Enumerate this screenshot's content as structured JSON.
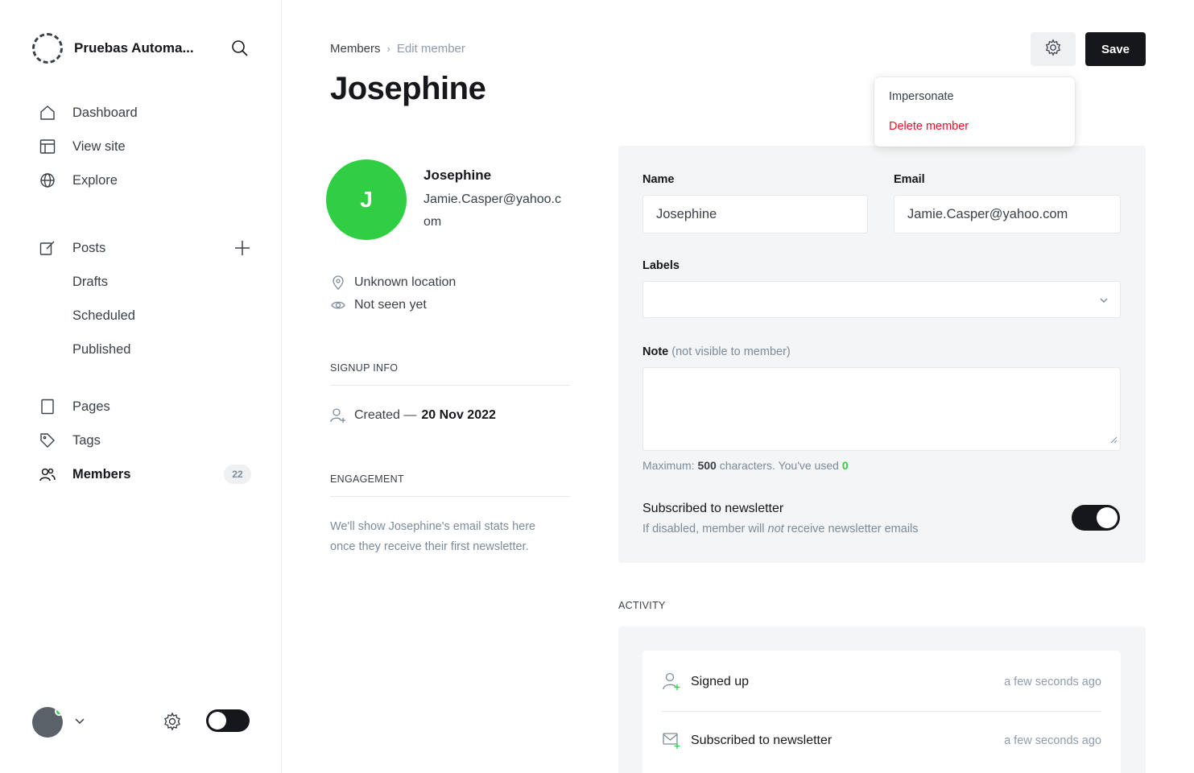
{
  "site": {
    "name": "Pruebas Automa..."
  },
  "nav": {
    "dashboard": "Dashboard",
    "view_site": "View site",
    "explore": "Explore",
    "posts": "Posts",
    "drafts": "Drafts",
    "scheduled": "Scheduled",
    "published": "Published",
    "pages": "Pages",
    "tags": "Tags",
    "members": "Members",
    "members_count": "22"
  },
  "breadcrumb": {
    "parent": "Members",
    "current": "Edit member"
  },
  "page": {
    "title": "Josephine"
  },
  "header": {
    "save_label": "Save"
  },
  "dropdown": {
    "impersonate": "Impersonate",
    "delete": "Delete member"
  },
  "profile": {
    "initial": "J",
    "name": "Josephine",
    "email": "Jamie.Casper@yahoo.com",
    "location": "Unknown location",
    "seen": "Not seen yet"
  },
  "signup": {
    "title": "SIGNUP INFO",
    "created_label": "Created —",
    "created_date": "20 Nov 2022"
  },
  "engagement": {
    "title": "ENGAGEMENT",
    "text": "We'll show Josephine's email stats here once they receive their first newsletter."
  },
  "form": {
    "name_label": "Name",
    "name_value": "Josephine",
    "email_label": "Email",
    "email_value": "Jamie.Casper@yahoo.com",
    "labels_label": "Labels",
    "note_label": "Note",
    "note_hint": "(not visible to member)",
    "max_prefix": "Maximum:",
    "max_value": "500",
    "max_mid": "characters. You've used",
    "used_value": "0",
    "newsletter_title": "Subscribed to newsletter",
    "newsletter_desc_pre": "If disabled, member will",
    "newsletter_desc_em": "not",
    "newsletter_desc_post": "receive newsletter emails",
    "newsletter_on": true
  },
  "activity": {
    "title": "ACTIVITY",
    "items": [
      {
        "label": "Signed up",
        "time": "a few seconds ago"
      },
      {
        "label": "Subscribed to newsletter",
        "time": "a few seconds ago"
      }
    ]
  },
  "colors": {
    "accent_green": "#30cf43",
    "danger": "#f50b23",
    "dark": "#15171a"
  }
}
